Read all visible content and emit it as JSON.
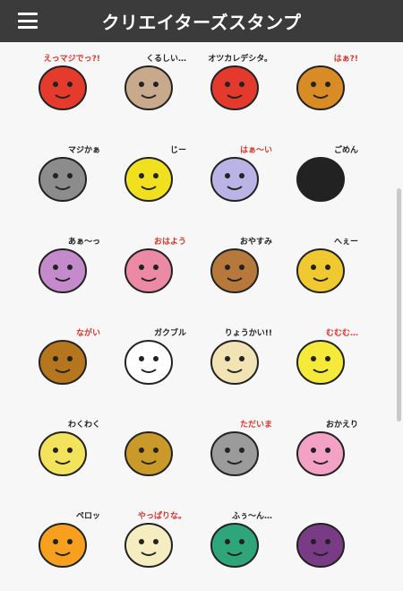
{
  "header": {
    "title": "クリエイターズスタンプ",
    "menu_icon": "hamburger-menu-icon"
  },
  "stickers": [
    {
      "name": "parrot-sticker",
      "text": "えっマジでっ?!",
      "color": "#e53b2c"
    },
    {
      "name": "kurushii-sticker",
      "text": "くるしい…",
      "color": "#c8a98b"
    },
    {
      "name": "otsukare-fish-sticker",
      "text": "オツカレデシタ。",
      "color": "#e43a2e"
    },
    {
      "name": "lion-sticker",
      "text": "はぁ?!",
      "color": "#d98b26"
    },
    {
      "name": "gorilla-sticker",
      "text": "マジかぁ",
      "color": "#8c8c8c"
    },
    {
      "name": "giraffe-sticker",
      "text": "じー",
      "color": "#f0e020"
    },
    {
      "name": "bird-sticker",
      "text": "はぁ～い",
      "color": "#b9b3e6"
    },
    {
      "name": "panda-sticker",
      "text": "ごめん",
      "color": "#222222"
    },
    {
      "name": "grandma-sticker",
      "text": "あぁ～っ",
      "color": "#c58acb"
    },
    {
      "name": "rabbit-sticker",
      "text": "おはよう",
      "color": "#ec8aa5"
    },
    {
      "name": "bear-sticker",
      "text": "おやすみ",
      "color": "#b7793b"
    },
    {
      "name": "cat-sticker",
      "text": "へぇー",
      "color": "#f0c830"
    },
    {
      "name": "ferret-sticker",
      "text": "ながい",
      "color": "#b5761e"
    },
    {
      "name": "sheep-sticker",
      "text": "ガクブル",
      "color": "#ffffff"
    },
    {
      "name": "dog-sticker",
      "text": "りょうかい!!",
      "color": "#f2e3b5"
    },
    {
      "name": "yellow-cat-sticker",
      "text": "むむむ…",
      "color": "#f5ea3a"
    },
    {
      "name": "lion2-sticker",
      "text": "わくわく",
      "color": "#f3e25c"
    },
    {
      "name": "fox-sticker",
      "text": "",
      "color": "#c99a2a"
    },
    {
      "name": "koala-sticker",
      "text": "ただいま",
      "color": "#9b9b9b"
    },
    {
      "name": "pink-cat-sticker",
      "text": "おかえり",
      "color": "#f3a1c4"
    },
    {
      "name": "round-sticker",
      "text": "ペロッ",
      "color": "#f7a020"
    },
    {
      "name": "bear2-sticker",
      "text": "やっぱりな。",
      "color": "#f5edc0"
    },
    {
      "name": "green-dog-sticker",
      "text": "ふぅ～ん…",
      "color": "#2fa67a"
    },
    {
      "name": "otter-sticker",
      "text": "",
      "color": "#7a3b86"
    }
  ]
}
